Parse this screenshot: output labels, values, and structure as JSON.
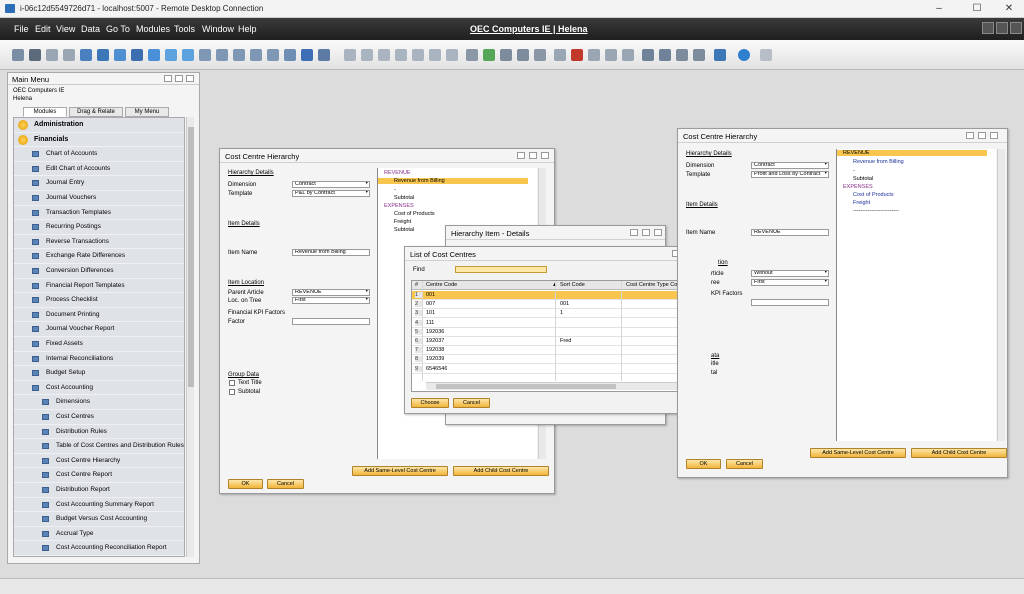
{
  "rdp": {
    "title": "i-06c12d5549726d71 - localhost:5007 - Remote Desktop Connection",
    "min": "–",
    "max": "☐",
    "close": "✕"
  },
  "app": {
    "menu": [
      "File",
      "Edit",
      "View",
      "Data",
      "Go To",
      "Modules",
      "Tools",
      "Window",
      "Help"
    ],
    "company_title": "OEC Computers IE | Helena",
    "accent": "#f2b53b",
    "selected": "#f8c64e"
  },
  "main_menu": {
    "title": "Main Menu",
    "company": "OEC Computers IE",
    "user": "Helena",
    "tabs": [
      "Modules",
      "Drag & Relate",
      "My Menu"
    ],
    "items": [
      {
        "label": "Administration",
        "level": 0,
        "bold": true,
        "icon": "folder-icon"
      },
      {
        "label": "Financials",
        "level": 0,
        "bold": true,
        "icon": "financials-icon"
      },
      {
        "label": "Chart of Accounts",
        "level": 1
      },
      {
        "label": "Edit Chart of Accounts",
        "level": 1
      },
      {
        "label": "Journal Entry",
        "level": 1
      },
      {
        "label": "Journal Vouchers",
        "level": 1
      },
      {
        "label": "Transaction Templates",
        "level": 1
      },
      {
        "label": "Recurring Postings",
        "level": 1
      },
      {
        "label": "Reverse Transactions",
        "level": 1
      },
      {
        "label": "Exchange Rate Differences",
        "level": 1
      },
      {
        "label": "Conversion Differences",
        "level": 1
      },
      {
        "label": "Financial Report Templates",
        "level": 1
      },
      {
        "label": "Process Checklist",
        "level": 1
      },
      {
        "label": "Document Printing",
        "level": 1
      },
      {
        "label": "Journal Voucher Report",
        "level": 1
      },
      {
        "label": "Fixed Assets",
        "level": 1
      },
      {
        "label": "Internal Reconciliations",
        "level": 1
      },
      {
        "label": "Budget Setup",
        "level": 1
      },
      {
        "label": "Cost Accounting",
        "level": 1
      },
      {
        "label": "Dimensions",
        "level": 2
      },
      {
        "label": "Cost Centres",
        "level": 2
      },
      {
        "label": "Distribution Rules",
        "level": 2
      },
      {
        "label": "Table of Cost Centres and Distribution Rules",
        "level": 2
      },
      {
        "label": "Cost Centre Hierarchy",
        "level": 2
      },
      {
        "label": "Cost Centre Report",
        "level": 2
      },
      {
        "label": "Distribution Report",
        "level": 2
      },
      {
        "label": "Cost Accounting Summary Report",
        "level": 2
      },
      {
        "label": "Budget Versus Cost Accounting",
        "level": 2
      },
      {
        "label": "Accrual Type",
        "level": 2
      },
      {
        "label": "Cost Accounting Reconciliation Report",
        "level": 2
      }
    ]
  },
  "cch1": {
    "title": "Cost Centre Hierarchy",
    "hier_details": "Hierarchy Details",
    "dimension_label": "Dimension",
    "dimension_value": "Contract",
    "template_label": "Template",
    "template_value": "P&L by Contract",
    "item_details": "Item Details",
    "item_name_label": "Item Name",
    "item_name_value": "Revenue from Billing",
    "item_location": "Item Location",
    "parent_label": "Parent Article",
    "parent_value": "REVENUE",
    "loc_label": "Loc. on Tree",
    "loc_value": "First",
    "kpi_label": "Financial KPI Factors",
    "factor_label": "Factor",
    "group_data": "Group Data",
    "text_title": "Text Title",
    "subtotal": "Subtotal",
    "tree": [
      "REVENUE",
      "Revenue from Billing",
      "-",
      "Subtotal",
      "EXPENSES",
      "Cost of Products",
      "Freight",
      "Subtotal"
    ],
    "add_same": "Add Same-Level Cost Centre",
    "add_child": "Add Child Cost Centre",
    "ok": "OK",
    "cancel": "Cancel"
  },
  "hid": {
    "title": "Hierarchy Item - Details"
  },
  "lcc": {
    "title": "List of Cost Centres",
    "find_label": "Find",
    "columns": [
      "#",
      "Centre Code",
      "Sort Code",
      "Cost Centre Type Code"
    ],
    "rows": [
      [
        "1",
        "001",
        "",
        ""
      ],
      [
        "2",
        "007",
        "001",
        ""
      ],
      [
        "3",
        "101",
        "1",
        ""
      ],
      [
        "4",
        "111",
        "",
        ""
      ],
      [
        "5",
        "192036",
        "",
        ""
      ],
      [
        "6",
        "192037",
        "Fred",
        ""
      ],
      [
        "7",
        "192038",
        "",
        ""
      ],
      [
        "8",
        "192039",
        "",
        ""
      ],
      [
        "9",
        "6546546",
        "",
        ""
      ]
    ],
    "choose": "Choose",
    "cancel": "Cancel"
  },
  "cch2": {
    "title": "Cost Centre Hierarchy",
    "hier_details": "Hierarchy Details",
    "dimension_label": "Dimension",
    "dimension_value": "Contract",
    "template_label": "Template",
    "template_value": "Profit and Loss by Contract",
    "item_details": "Item Details",
    "item_name_label": "Item Name",
    "item_name_value": "REVENUE",
    "frag_location": "tion",
    "frag_article": "rticle",
    "article_value": "Without",
    "frag_tree": "ree",
    "tree_value": "First",
    "frag_kpi": "KPI Factors",
    "frag_ata": "ata",
    "frag_title": "itle",
    "frag_tal": "tal",
    "tree": [
      "REVENUE",
      "Revenue from Billing",
      "-",
      "Subtotal",
      "EXPENSES",
      "Cost of Products",
      "Freight",
      "-------------------------"
    ],
    "add_same": "Add Same-Level Cost Centre",
    "add_child": "Add Child Cost Centre",
    "ok": "OK",
    "cancel": "Cancel"
  }
}
